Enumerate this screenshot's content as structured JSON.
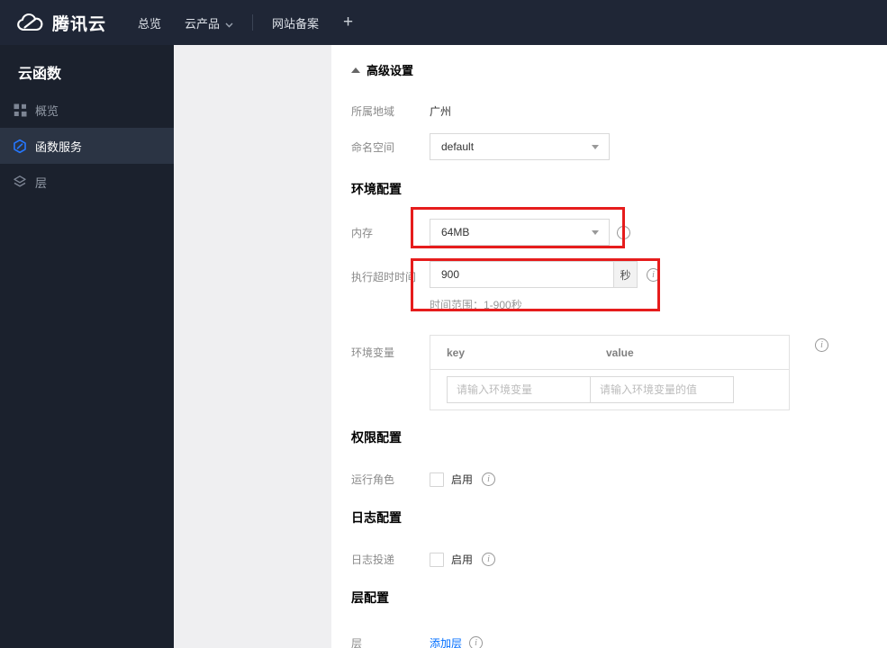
{
  "navbar": {
    "brand": "腾讯云",
    "items": [
      {
        "label": "总览"
      },
      {
        "label": "云产品"
      },
      {
        "label": "网站备案"
      },
      {
        "label": "+"
      }
    ]
  },
  "sidebar": {
    "title": "云函数",
    "items": [
      {
        "label": "概览",
        "icon": "overview-grid-icon",
        "active": false
      },
      {
        "label": "函数服务",
        "icon": "scf-hexagon-icon",
        "active": true
      },
      {
        "label": "层",
        "icon": "layers-icon",
        "active": false
      }
    ]
  },
  "content": {
    "advanced_settings_label": "高级设置",
    "sections": {
      "env": "环境配置",
      "permission": "权限配置",
      "logging": "日志配置",
      "layer": "层配置"
    },
    "rows": {
      "region": {
        "label": "所属地域",
        "value": "广州"
      },
      "namespace": {
        "label": "命名空间",
        "value": "default"
      },
      "memory": {
        "label": "内存",
        "value": "64MB"
      },
      "timeout": {
        "label": "执行超时时间",
        "value": "900",
        "unit": "秒",
        "hint": "时间范围：1-900秒"
      },
      "env_vars": {
        "label": "环境变量",
        "key_header": "key",
        "value_header": "value",
        "key_placeholder": "请输入环境变量",
        "value_placeholder": "请输入环境变量的值"
      },
      "role": {
        "label": "运行角色",
        "checkbox_label": "启用"
      },
      "log": {
        "label": "日志投递",
        "checkbox_label": "启用"
      },
      "layer": {
        "label": "层",
        "link_label": "添加层"
      }
    }
  },
  "colors": {
    "accent_blue": "#006eff",
    "annotation_red": "#e61c1c",
    "navbar_bg": "#1f2636",
    "sidebar_bg": "#1b212d"
  }
}
